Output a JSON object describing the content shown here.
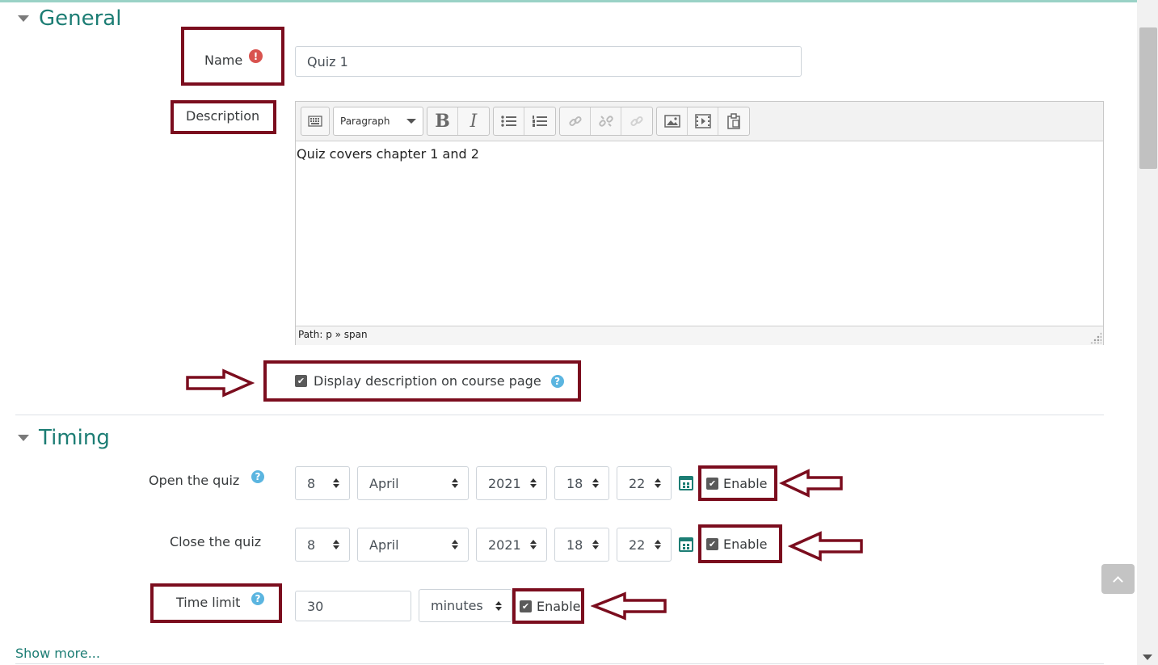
{
  "general": {
    "title": "General",
    "name_label": "Name",
    "name_required_icon": "exclamation-icon",
    "name_value": "Quiz 1",
    "description_label": "Description",
    "editor": {
      "format_select": "Paragraph",
      "bold": "B",
      "italic": "I",
      "content": "Quiz covers chapter 1 and 2",
      "path": "Path: p » span"
    },
    "display_description_label": "Display description on course page"
  },
  "timing": {
    "title": "Timing",
    "open_label": "Open the quiz",
    "open": {
      "day": "8",
      "month": "April",
      "year": "2021",
      "hour": "18",
      "minute": "22",
      "enable_label": "Enable"
    },
    "close_label": "Close the quiz",
    "close": {
      "day": "8",
      "month": "April",
      "year": "2021",
      "hour": "18",
      "minute": "22",
      "enable_label": "Enable"
    },
    "timelimit_label": "Time limit",
    "timelimit_value": "30",
    "timelimit_unit": "minutes",
    "timelimit_enable_label": "Enable"
  },
  "show_more": "Show more...",
  "help_glyph": "?",
  "required_glyph": "!",
  "colors": {
    "accent": "#1c7d74",
    "annotation": "#7b0d1e",
    "help": "#5bb5e0",
    "required": "#d9534f"
  }
}
